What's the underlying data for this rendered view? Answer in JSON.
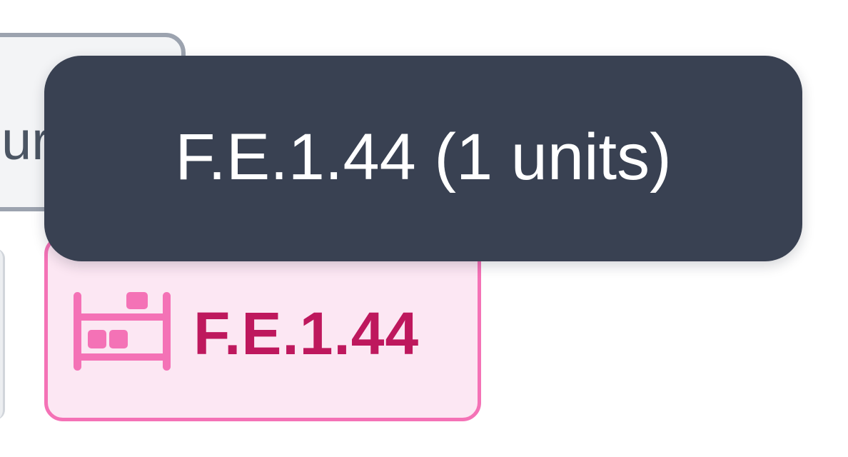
{
  "background_chip": {
    "text_fragment": "ur"
  },
  "location_chip": {
    "label": "F.E.1.44",
    "icon": "shelf-icon",
    "colors": {
      "background": "#fce7f3",
      "border": "#f472b6",
      "text": "#be185d",
      "icon": "#f472b6"
    }
  },
  "tooltip": {
    "text": "F.E.1.44 (1 units)",
    "background": "#394152",
    "text_color": "#ffffff"
  }
}
